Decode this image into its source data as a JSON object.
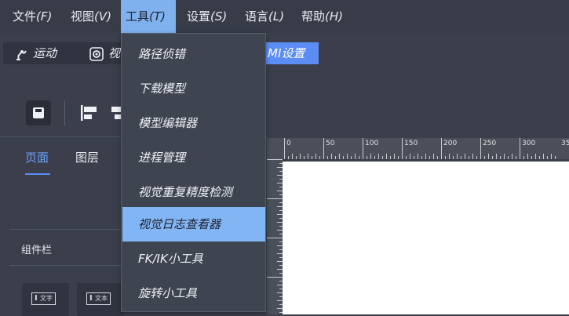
{
  "menubar": {
    "items": [
      {
        "label": "文件",
        "accel": "(F)"
      },
      {
        "label": "视图",
        "accel": "(V)"
      },
      {
        "label": "工具",
        "accel": "(T)"
      },
      {
        "label": "设置",
        "accel": "(S)"
      },
      {
        "label": "语言",
        "accel": "(L)"
      },
      {
        "label": "帮助",
        "accel": "(H)"
      }
    ]
  },
  "modebar": {
    "motion_label": "运动",
    "vision_label": "视",
    "hmi_label": "MI设置"
  },
  "leftpanel": {
    "tabs": [
      "页面",
      "图层"
    ],
    "component_bar_label": "组件栏",
    "components": [
      "文字",
      "文本"
    ]
  },
  "ruler": {
    "ticks": [
      "0",
      "50",
      "100",
      "150",
      "200",
      "250",
      "300",
      "35"
    ]
  },
  "tools_menu": {
    "items": [
      "路径侦错",
      "下载模型",
      "模型编辑器",
      "进程管理",
      "视觉重复精度检测",
      "视觉日志查看器",
      "FK/IK小工具",
      "旋转小工具"
    ],
    "highlighted_index": 5
  },
  "colors": {
    "accent": "#5b8df5",
    "highlight": "#82b5f3",
    "menubar_bg": "#373c48",
    "panel_bg": "#3a3f4b"
  }
}
